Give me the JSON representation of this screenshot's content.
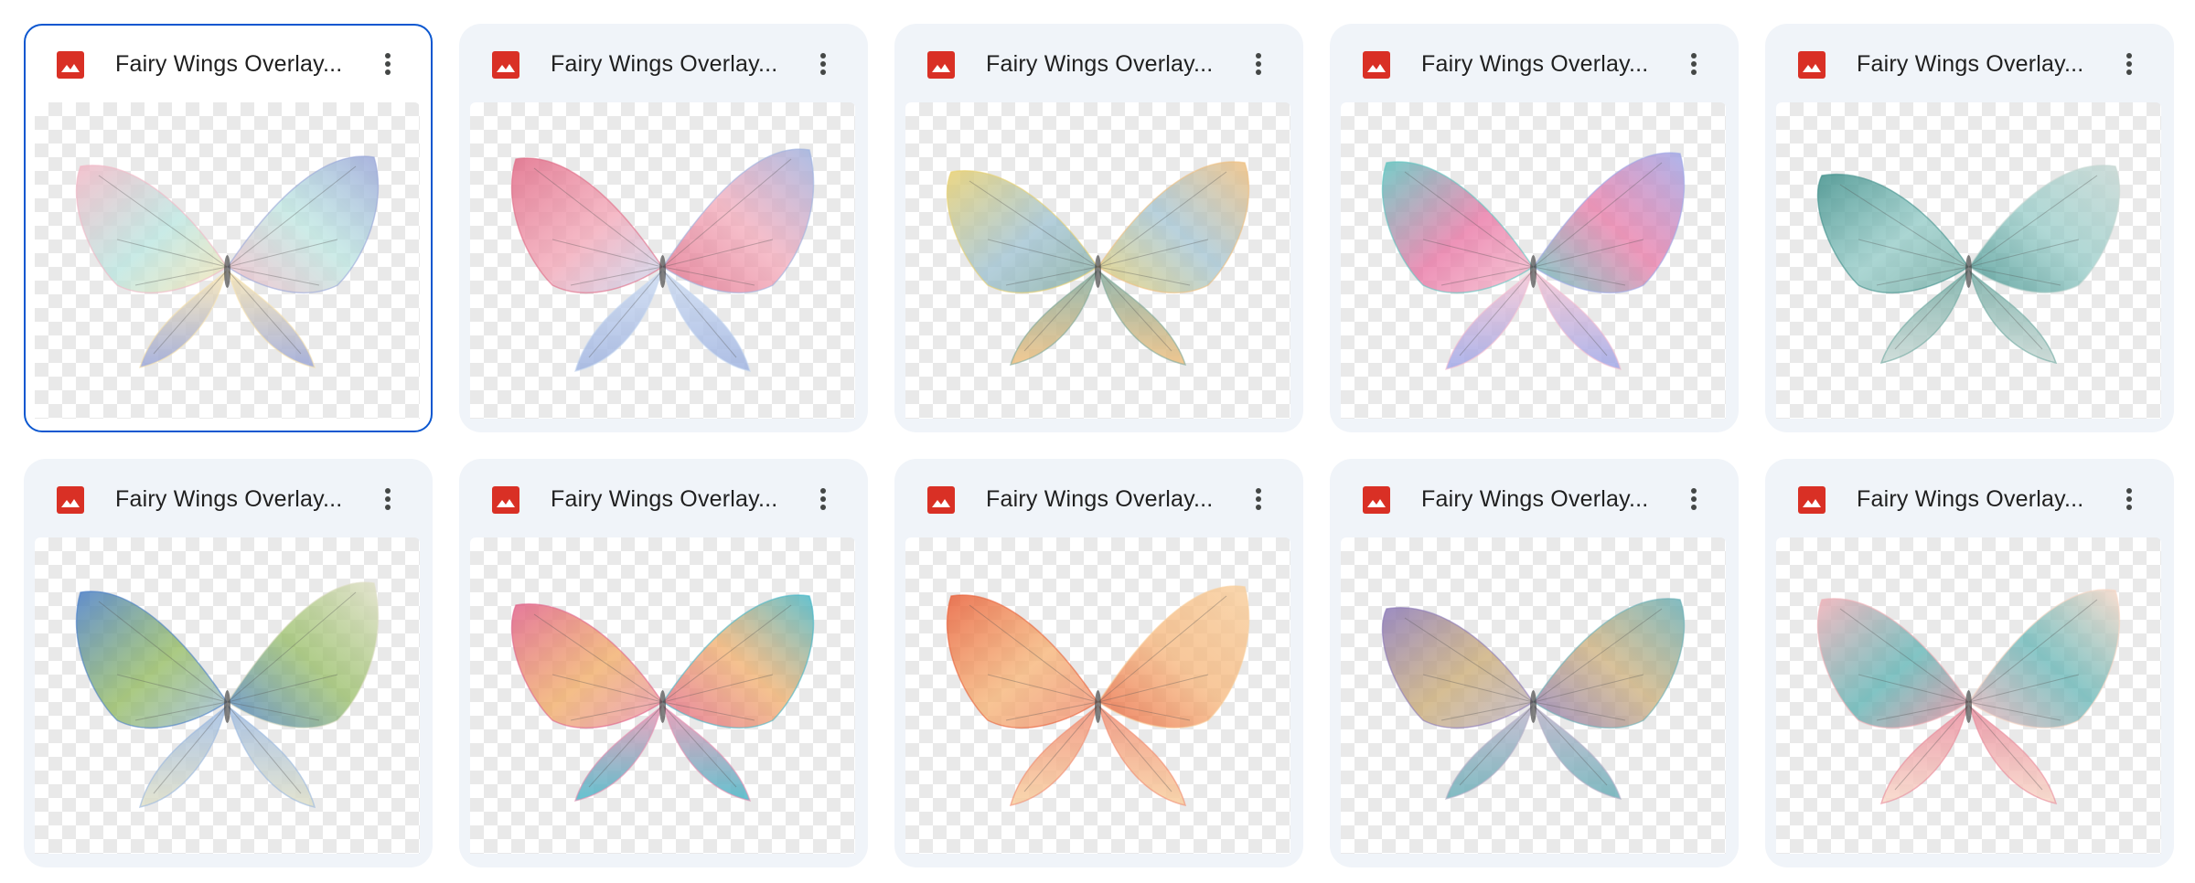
{
  "files": [
    {
      "title": "Fairy Wings Overlay...",
      "selected": true,
      "palette": [
        "#f2b8c6",
        "#b7e4de",
        "#9aa6d8",
        "#f6e3b0"
      ]
    },
    {
      "title": "Fairy Wings Overlay...",
      "selected": false,
      "palette": [
        "#e06a86",
        "#f2a3b4",
        "#9fb3e0",
        "#c8d8f0"
      ]
    },
    {
      "title": "Fairy Wings Overlay...",
      "selected": false,
      "palette": [
        "#e8d070",
        "#9bbfcf",
        "#f0c080",
        "#7fa89a"
      ]
    },
    {
      "title": "Fairy Wings Overlay...",
      "selected": false,
      "palette": [
        "#5fc5c0",
        "#e86fa0",
        "#9fa8e8",
        "#f5c0d0"
      ]
    },
    {
      "title": "Fairy Wings Overlay...",
      "selected": false,
      "palette": [
        "#3f8f8a",
        "#8fc8c4",
        "#c8d8d4",
        "#6ea8a0"
      ]
    },
    {
      "title": "Fairy Wings Overlay...",
      "selected": false,
      "palette": [
        "#4a7ec8",
        "#8fb85a",
        "#e0e0c8",
        "#9ab8e0"
      ]
    },
    {
      "title": "Fairy Wings Overlay...",
      "selected": false,
      "palette": [
        "#e0628a",
        "#f0a860",
        "#48b8c8",
        "#e890b0"
      ]
    },
    {
      "title": "Fairy Wings Overlay...",
      "selected": false,
      "palette": [
        "#e8603a",
        "#f5b070",
        "#f8d0a0",
        "#f08a70"
      ]
    },
    {
      "title": "Fairy Wings Overlay...",
      "selected": false,
      "palette": [
        "#8a78b8",
        "#c8a870",
        "#6ab0b8",
        "#b8b0c8"
      ]
    },
    {
      "title": "Fairy Wings Overlay...",
      "selected": false,
      "palette": [
        "#f0b0b8",
        "#58b0b0",
        "#f8d8c8",
        "#e8889a"
      ]
    }
  ],
  "icons": {
    "file_type": "image-file-icon",
    "more": "more-vert-icon"
  },
  "colors": {
    "file_icon": "#d93025",
    "card_bg": "#f0f4f9",
    "selected_border": "#0b57d0",
    "title_text": "#1f1f1f"
  }
}
